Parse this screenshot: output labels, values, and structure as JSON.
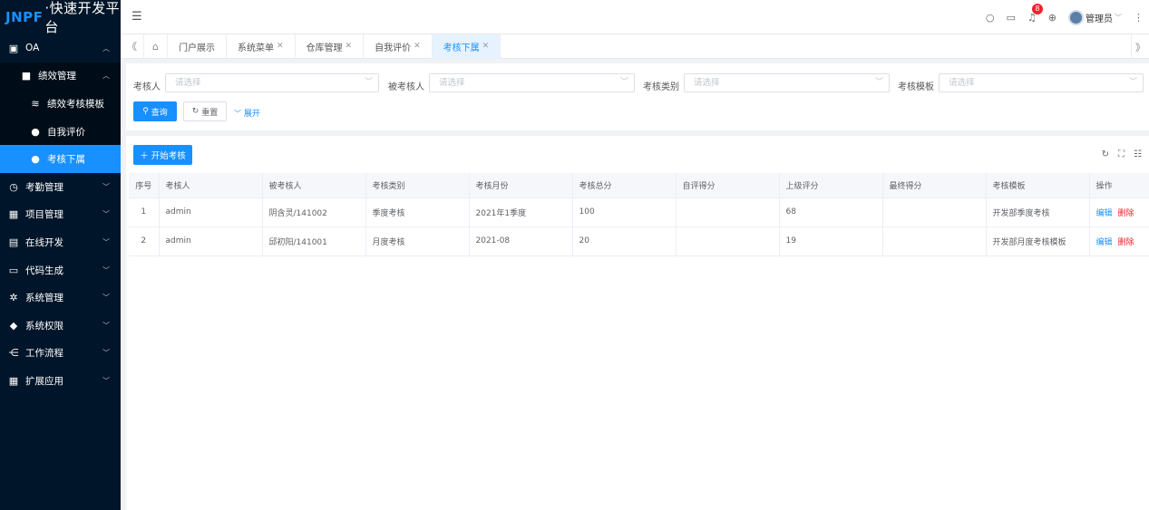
{
  "app": {
    "logo_brand": "JNPF",
    "logo_text": "·快速开发平台"
  },
  "sidebar": {
    "items": [
      {
        "label": "OA",
        "icon": "monitor-icon",
        "level": 0,
        "expanded": true
      },
      {
        "label": "绩效管理",
        "icon": "clipboard-icon",
        "level": 1,
        "expanded": true
      },
      {
        "label": "绩效考核模板",
        "icon": "layers-icon",
        "level": 2
      },
      {
        "label": "自我评价",
        "icon": "user-icon",
        "level": 2
      },
      {
        "label": "考核下属",
        "icon": "user-check-icon",
        "level": 2,
        "active": true
      },
      {
        "label": "考勤管理",
        "icon": "clock-icon",
        "level": 0
      },
      {
        "label": "项目管理",
        "icon": "grid-icon",
        "level": 0
      },
      {
        "label": "在线开发",
        "icon": "code-icon",
        "level": 0
      },
      {
        "label": "代码生成",
        "icon": "terminal-icon",
        "level": 0
      },
      {
        "label": "系统管理",
        "icon": "gear-icon",
        "level": 0
      },
      {
        "label": "系统权限",
        "icon": "shield-icon",
        "level": 0
      },
      {
        "label": "工作流程",
        "icon": "share-icon",
        "level": 0
      },
      {
        "label": "扩展应用",
        "icon": "apps-icon",
        "level": 0
      }
    ]
  },
  "header": {
    "notification_count": "8",
    "user_name": "管理员"
  },
  "tabs": [
    {
      "label": "门户展示",
      "closable": false
    },
    {
      "label": "系统菜单",
      "closable": true
    },
    {
      "label": "仓库管理",
      "closable": true
    },
    {
      "label": "自我评价",
      "closable": true
    },
    {
      "label": "考核下属",
      "closable": true,
      "active": true
    }
  ],
  "search": {
    "fields": [
      {
        "label": "考核人",
        "placeholder": "请选择"
      },
      {
        "label": "被考核人",
        "placeholder": "请选择"
      },
      {
        "label": "考核类别",
        "placeholder": "请选择"
      },
      {
        "label": "考核模板",
        "placeholder": "请选择"
      }
    ],
    "query_label": "查询",
    "reset_label": "重置",
    "expand_label": "展开"
  },
  "table": {
    "start_button": "开始考核",
    "columns": [
      "序号",
      "考核人",
      "被考核人",
      "考核类别",
      "考核月份",
      "考核总分",
      "自评得分",
      "上级评分",
      "最终得分",
      "考核模板",
      "操作"
    ],
    "rows": [
      {
        "index": "1",
        "assessor": "admin",
        "assessee": "阴含灵/141002",
        "category": "季度考核",
        "month": "2021年1季度",
        "total": "100",
        "self": "",
        "superior": "68",
        "final": "",
        "template": "开发部季度考核",
        "edit": "编辑",
        "delete": "删除"
      },
      {
        "index": "2",
        "assessor": "admin",
        "assessee": "邱初阳/141001",
        "category": "月度考核",
        "month": "2021-08",
        "total": "20",
        "self": "",
        "superior": "19",
        "final": "",
        "template": "开发部月度考核模板",
        "edit": "编辑",
        "delete": "删除"
      }
    ]
  },
  "colors": {
    "sidebar_bg": "#001529",
    "accent": "#1890ff",
    "danger": "#f5222d"
  }
}
